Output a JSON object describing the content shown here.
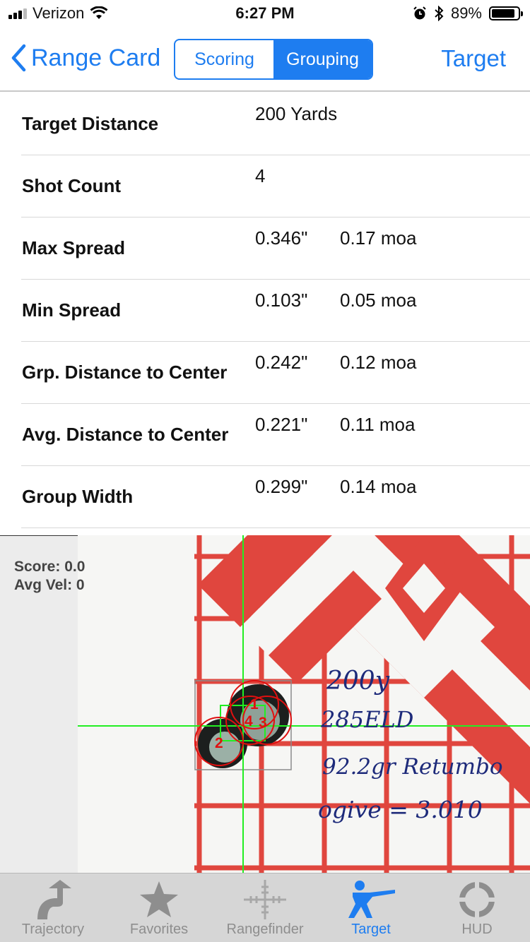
{
  "status_bar": {
    "carrier": "Verizon",
    "time": "6:27 PM",
    "battery": "89%",
    "battery_level": 0.89
  },
  "nav": {
    "back_label": "Range Card",
    "segments": [
      "Scoring",
      "Grouping"
    ],
    "selected_segment": "Grouping",
    "right_button": "Target",
    "accent_color": "#1e7df0"
  },
  "stats": [
    {
      "label": "Target Distance",
      "value": "200 Yards",
      "moa": ""
    },
    {
      "label": "Shot Count",
      "value": "4",
      "moa": ""
    },
    {
      "label": "Max Spread",
      "value": "0.346\"",
      "moa": "0.17 moa"
    },
    {
      "label": "Min Spread",
      "value": "0.103\"",
      "moa": "0.05 moa"
    },
    {
      "label": "Grp. Distance to Center",
      "value": "0.242\"",
      "moa": "0.12 moa"
    },
    {
      "label": "Avg. Distance to Center",
      "value": "0.221\"",
      "moa": "0.11 moa"
    },
    {
      "label": "Group Width",
      "value": "0.299\"",
      "moa": "0.14 moa"
    }
  ],
  "target_view": {
    "score": "Score: 0.0",
    "avg_vel": "Avg Vel: 0",
    "shot_labels": [
      "1",
      "2",
      "3",
      "4"
    ],
    "notes": [
      "200y",
      "285ELD",
      "92.2gr Retumbo",
      "ogive = 3.010"
    ],
    "crosshair_color": "#22ee22",
    "shot_color": "#e01010"
  },
  "tabbar": {
    "tabs": [
      {
        "label": "Trajectory",
        "icon": "trajectory-icon"
      },
      {
        "label": "Favorites",
        "icon": "star-icon"
      },
      {
        "label": "Rangefinder",
        "icon": "crosshair-icon"
      },
      {
        "label": "Target",
        "icon": "shooter-icon"
      },
      {
        "label": "HUD",
        "icon": "hud-icon"
      }
    ],
    "selected": "Target"
  }
}
